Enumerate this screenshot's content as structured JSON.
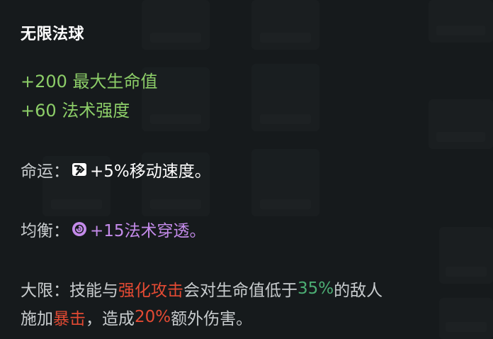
{
  "item": {
    "name": "无限法球",
    "stats": [
      "+200 最大生命值",
      "+60 法术强度"
    ]
  },
  "fate": {
    "label": "命运：",
    "icon": "move-speed-icon",
    "bonus": "+5%移动速度。"
  },
  "balance": {
    "label": "均衡：",
    "icon": "magic-pen-icon",
    "bonus": "+15法术穿透。"
  },
  "limit": {
    "label": "大限：",
    "line1_part1": "技能与",
    "line1_highlight1": "强化攻击",
    "line1_part2": "会对生命值低于",
    "line1_threshold": "35%",
    "line1_part3": "的敌人",
    "line2_part1": "施加",
    "line2_highlight": "暴击",
    "line2_part2": "，造成",
    "line2_damage": "20%",
    "line2_part3": "额外伤害。"
  },
  "colors": {
    "background": "#161a1c",
    "stat_green": "#8ccd68",
    "body_text": "#c8ccce",
    "magic_purple": "#c48bea",
    "empower_red": "#e34a33",
    "threshold_green": "#4cae74"
  }
}
